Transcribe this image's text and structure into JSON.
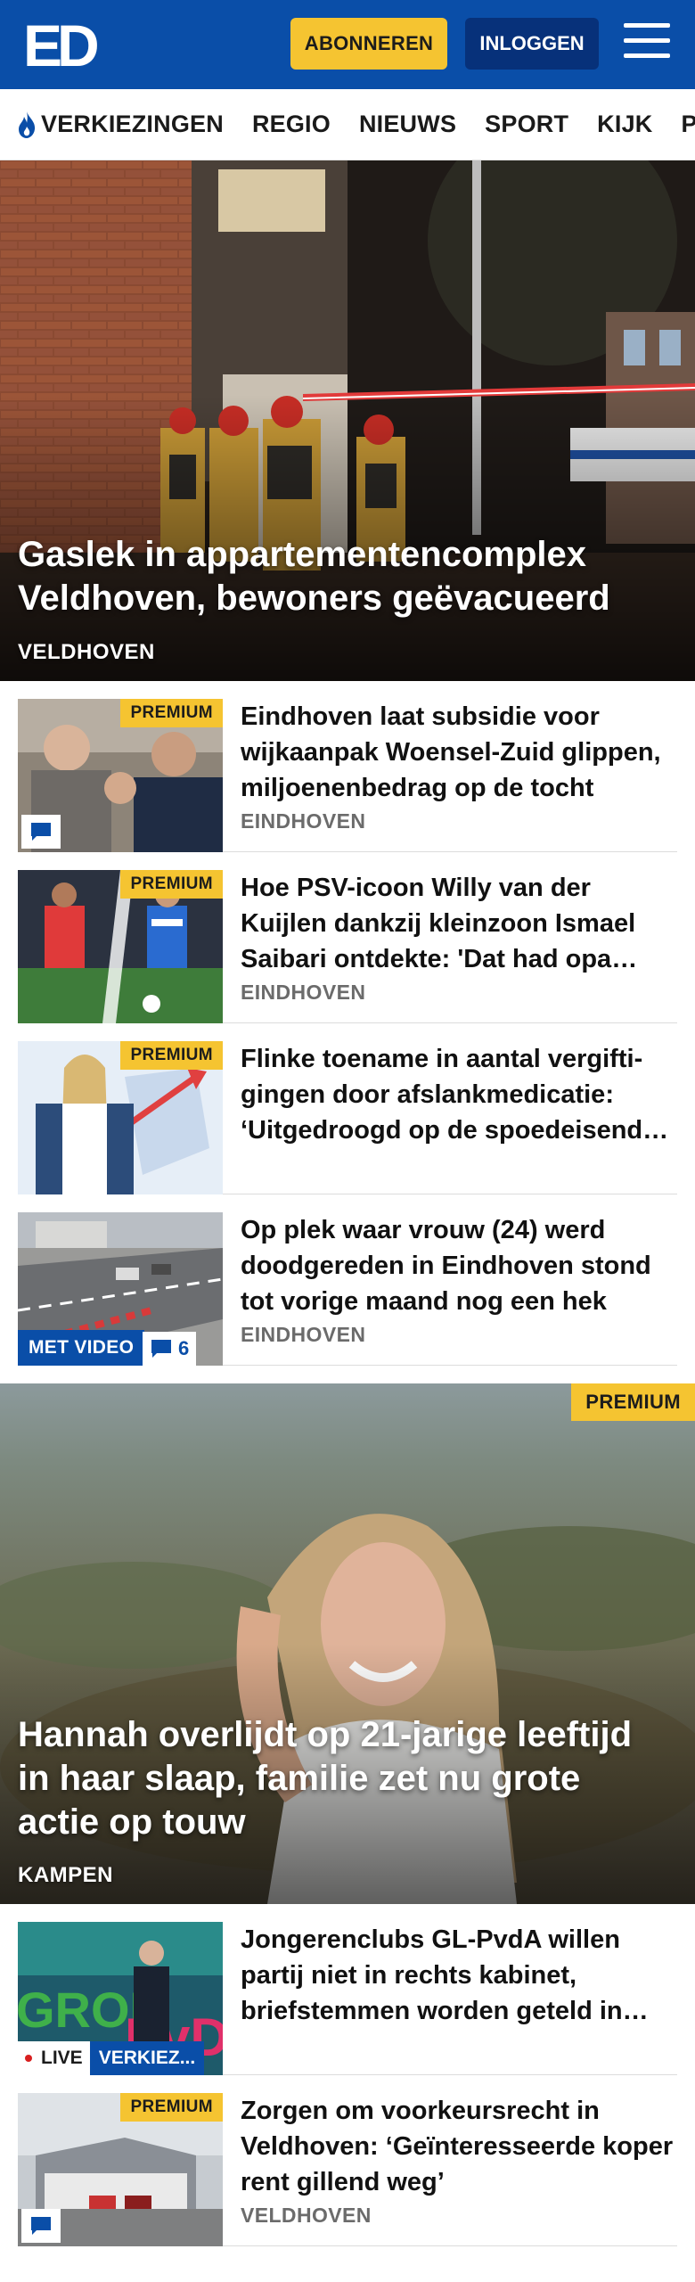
{
  "header": {
    "logo_text": "ED",
    "subscribe_label": "ABONNEREN",
    "login_label": "INLOGGEN",
    "menu_icon": "hamburger-menu-icon",
    "brand_color": "#0a4ea8",
    "accent_color": "#f5c431"
  },
  "nav": {
    "items": [
      {
        "label": "VERKIEZINGEN",
        "icon": "flame-icon"
      },
      {
        "label": "REGIO"
      },
      {
        "label": "NIEUWS"
      },
      {
        "label": "SPORT"
      },
      {
        "label": "KIJK"
      },
      {
        "label": "PODC"
      }
    ]
  },
  "hero": {
    "title": "Gaslek in appartementencomplex Veldhoven, bewoners geëvacueerd",
    "location": "VELDHOVEN"
  },
  "articles_1": [
    {
      "title": "Eindhoven laat subsidie voor wijkaanpak Woensel-Zuid glippen, miljoenenbedrag op de tocht",
      "location": "EINDHOVEN",
      "badge": "PREMIUM"
    },
    {
      "title": "Hoe PSV-icoon Willy van der Kuijlen dankzij kleinzoon Ismael Saibari ontdekte: 'Dat had opa mooi gevonden'",
      "location": "EINDHOVEN",
      "badge": "PREMIUM"
    },
    {
      "title": "Flinke toename in aantal vergifti­gingen door afslankmedicatie: ‘Uitgedroogd op de spoedeisende hulp’",
      "location": "",
      "badge": "PREMIUM"
    },
    {
      "title": "Op plek waar vrouw (24) werd doodgereden in Eindhoven stond tot vorige maand nog een hek",
      "location": "EINDHOVEN",
      "video_label": "MET VIDEO",
      "comment_count": "6"
    }
  ],
  "hero2": {
    "badge": "PREMIUM",
    "title": "Hannah overlijdt op 21-jarige leeftijd in haar slaap, familie zet nu grote actie op touw",
    "location": "KAMPEN"
  },
  "articles_2": [
    {
      "title": "Jongerenclubs GL-PvdA willen partij niet in rechts kabinet, briefstemmen worden geteld in Den Haag",
      "live_label": "LIVE",
      "tag_label": "VERKIEZ..."
    },
    {
      "title": "Zorgen om voorkeursrecht in Veldhoven: ‘Geïnteresseerde koper rent gillend weg’",
      "location": "VELDHOVEN",
      "badge": "PREMIUM"
    }
  ]
}
